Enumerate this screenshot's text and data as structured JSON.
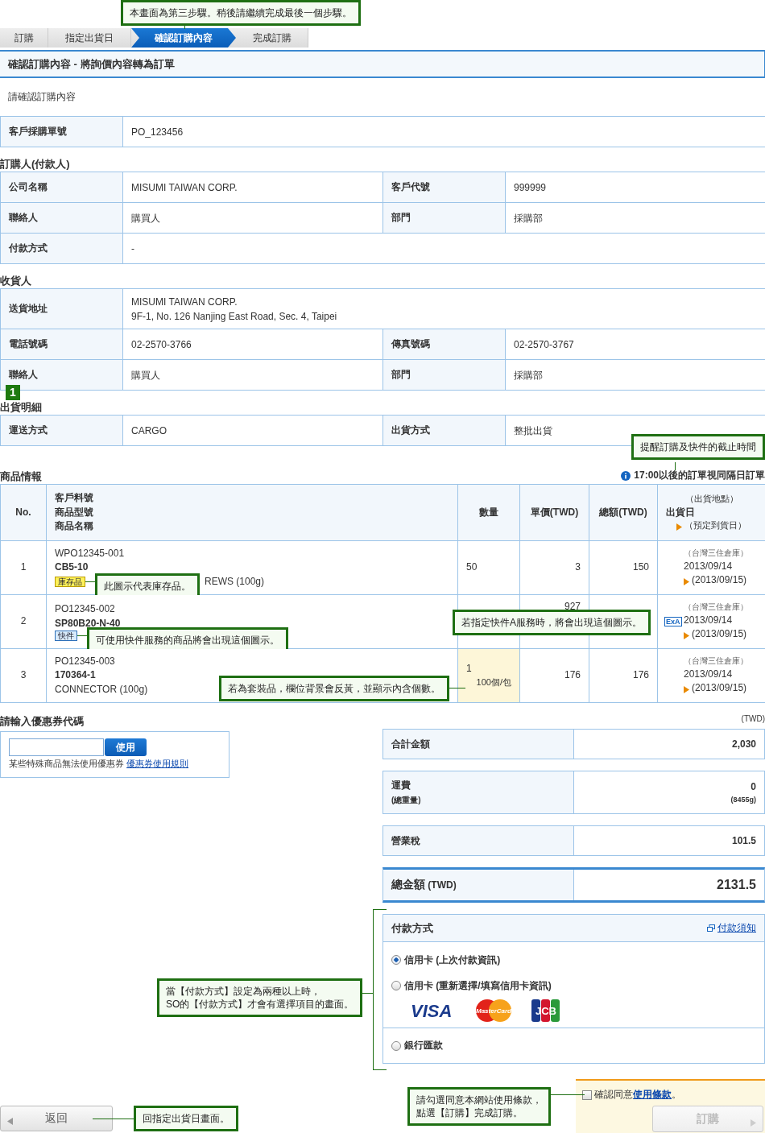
{
  "step_note": "本畫面為第三步驟。稍後請繼續完成最後一個步驟。",
  "steps": [
    {
      "label": "訂購",
      "selected": false
    },
    {
      "label": "指定出貨日",
      "selected": false
    },
    {
      "label": "確認訂購內容",
      "selected": true
    },
    {
      "label": "完成訂購",
      "selected": false
    }
  ],
  "page_title": "確認訂購內容 - 將詢價內容轉為訂單",
  "intro": "請確認訂購內容",
  "po": {
    "label": "客戶採購單號",
    "value": "PO_123456"
  },
  "sections": [
    {
      "title": "訂購人(付款人)",
      "rows": [
        [
          {
            "label": "公司名稱",
            "value": "MISUMI TAIWAN CORP."
          },
          {
            "label": "客戶代號",
            "value": "999999"
          }
        ],
        [
          {
            "label": "聯絡人",
            "value": "購買人"
          },
          {
            "label": "部門",
            "value": "採購部"
          }
        ],
        [
          {
            "label": "付款方式",
            "value": "-"
          }
        ]
      ]
    },
    {
      "title": "收貨人",
      "rows": [
        [
          {
            "label": "送貨地址",
            "lines": [
              "MISUMI TAIWAN CORP.",
              "9F-1, No. 126 Nanjing East Road, Sec. 4, Taipei"
            ]
          }
        ],
        [
          {
            "label": "電話號碼",
            "value": "02-2570-3766"
          },
          {
            "label": "傳真號碼",
            "value": "02-2570-3767"
          }
        ],
        [
          {
            "label": "聯絡人",
            "value": "購買人"
          },
          {
            "label": "部門",
            "value": "採購部"
          }
        ]
      ]
    },
    {
      "title": "出貨明細",
      "marker": "1",
      "rows": [
        [
          {
            "label": "運送方式",
            "value": "CARGO"
          },
          {
            "label": "出貨方式",
            "value": "整批出貨"
          }
        ]
      ]
    }
  ],
  "products": {
    "title": "商品情報",
    "notice": "17:00以後的訂單視同隔日訂單",
    "notice_callout": "提醒訂購及快件的截止時間",
    "columns": {
      "no": "No.",
      "item": [
        "客戶料號",
        "商品型號",
        "商品名稱"
      ],
      "qty": "數量",
      "unit": "單價(TWD)",
      "total": "總額(TWD)",
      "ship": [
        "（出貨地點）",
        "出貨日",
        "（預定到貨日）"
      ]
    },
    "rows": [
      {
        "no": "1",
        "part": "WPO12345-001",
        "model": "CB5-10",
        "badge": {
          "kind": "stock",
          "label": "庫存品"
        },
        "callout": "此圖示代表庫存品。",
        "name": "REWS (100g)",
        "qty": "50",
        "unit": "3",
        "total": "150",
        "place": "（台灣三住倉庫）",
        "ship": "2013/09/14",
        "arrive": "(2013/09/15)",
        "set": false
      },
      {
        "no": "2",
        "part": "PO12345-002",
        "model": "SP80B20-N-40",
        "badge": {
          "kind": "express",
          "label": "快件"
        },
        "callout": "可使用快件服務的商品將會出現這個圖示。",
        "unit": "927",
        "service_icon": "ExA",
        "service_callout": "若指定快件A服務時，將會出現這個圖示。",
        "place": "（台灣三住倉庫）",
        "ship": "2013/09/14",
        "arrive": "(2013/09/15)",
        "set": false
      },
      {
        "no": "3",
        "part": "PO12345-003",
        "model": "170364-1",
        "name": "CONNECTOR (100g)",
        "qty": "1",
        "set_note": "100個/包",
        "set_callout": "若為套裝品，欄位背景會反黃，並顯示內含個數。",
        "unit": "176",
        "total": "176",
        "place": "（台灣三住倉庫）",
        "ship": "2013/09/14",
        "arrive": "(2013/09/15)",
        "set": true
      }
    ]
  },
  "coupon": {
    "title": "請輸入優惠券代碼",
    "button": "使用",
    "note": "某些特殊商品無法使用優惠券",
    "link": "優惠券使用規則"
  },
  "totals": {
    "currency": "(TWD)",
    "rows": [
      {
        "kind": "normal",
        "label": "合計金額",
        "value": "2,030"
      },
      {
        "kind": "normal",
        "label": "運費",
        "sub_label": "(總重量)",
        "value": "0",
        "sub_value": "(8455g)"
      },
      {
        "kind": "normal",
        "label": "營業稅",
        "value": "101.5"
      },
      {
        "kind": "grand",
        "label": "總金額",
        "label_suffix": "(TWD)",
        "value": "2131.5"
      }
    ]
  },
  "payment": {
    "title": "付款方式",
    "link": "付款須知",
    "callout": [
      "當【付款方式】設定為兩種以上時，",
      "SO的【付款方式】才會有選擇項目的畫面。"
    ],
    "options": [
      {
        "label": "信用卡 (上次付款資訊)",
        "selected": true
      },
      {
        "label": "信用卡 (重新選擇/填寫信用卡資訊)",
        "selected": false,
        "cards": [
          "VISA",
          "MasterCard",
          "JCB"
        ]
      },
      {
        "label": "銀行匯款",
        "selected": false
      }
    ]
  },
  "back": {
    "label": "返回",
    "callout": "回指定出貨日畫面。"
  },
  "terms": {
    "callout": [
      "請勾選同意本網站使用條款，",
      "點選【訂購】完成訂購。"
    ],
    "checked": false,
    "text": "確認同意",
    "link": "使用條款",
    "tail": "。"
  },
  "order": {
    "label": "訂購",
    "disabled": true
  }
}
